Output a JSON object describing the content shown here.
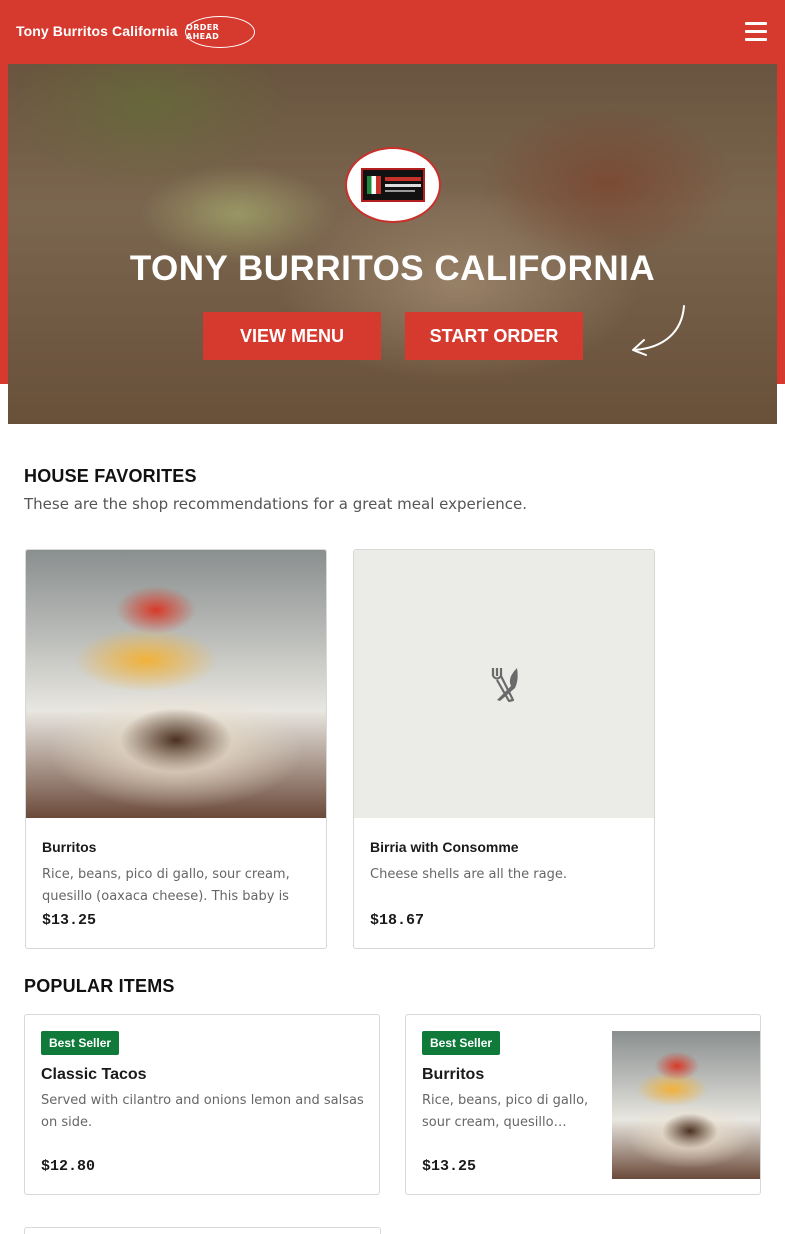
{
  "header": {
    "brand": "Tony Burritos California",
    "order_ahead": "ORDER AHEAD",
    "menu_icon": "hamburger-menu-icon"
  },
  "hero": {
    "title": "TONY BURRITOS CALIFORNIA",
    "view_menu": "VIEW MENU",
    "start_order": "START ORDER",
    "arrow_icon": "curved-arrow-icon"
  },
  "house_favorites": {
    "title": "HOUSE FAVORITES",
    "subtitle": "These are the shop recommendations for a great meal experience.",
    "items": [
      {
        "name": "Burritos",
        "description": "Rice, beans, pico di gallo, sour cream, quesillo (oaxaca cheese). This baby is a…",
        "price": "$13.25"
      },
      {
        "name": "Birria with Consomme",
        "description": "Cheese shells are all the rage.",
        "price": "$18.67",
        "placeholder_icon": "fork-knife-icon"
      }
    ]
  },
  "popular_items": {
    "title": "POPULAR ITEMS",
    "items": [
      {
        "badge": "Best Seller",
        "name": "Classic Tacos",
        "description": "Served with cilantro and onions lemon and salsas on side.",
        "price": "$12.80"
      },
      {
        "badge": "Best Seller",
        "name": "Burritos",
        "description": "Rice, beans, pico di gallo, sour cream, quesillo…",
        "price": "$13.25"
      }
    ]
  },
  "colors": {
    "brand_red": "#d63a2f",
    "badge_green": "#0f7a3a"
  }
}
